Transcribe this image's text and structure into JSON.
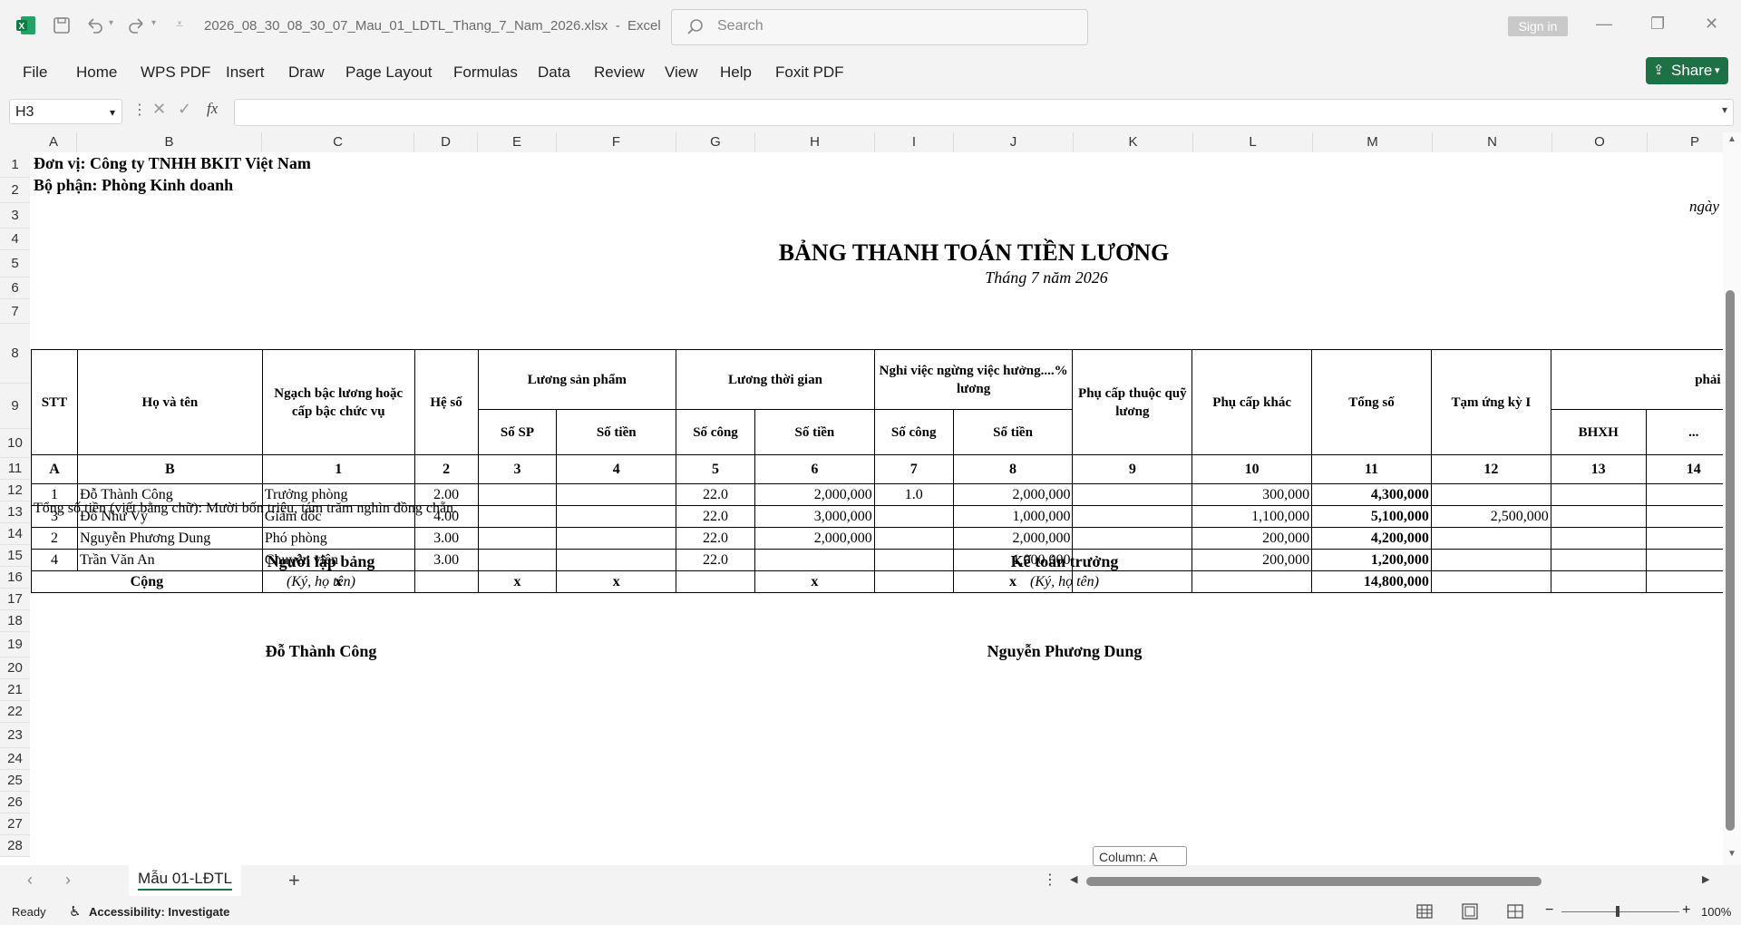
{
  "app": {
    "file_name": "2026_08_30_08_30_07_Mau_01_LDTL_Thang_7_Nam_2026.xlsx",
    "separator": "-",
    "app_name": "Excel",
    "search_placeholder": "Search",
    "sign_in": "Sign in",
    "share_label": "Share"
  },
  "ribbon_tabs": [
    "File",
    "Home",
    "WPS PDF",
    "Insert",
    "Draw",
    "Page Layout",
    "Formulas",
    "Data",
    "Review",
    "View",
    "Help",
    "Foxit PDF"
  ],
  "formula_bar": {
    "cell_ref": "H3",
    "fx": "fx",
    "formula": ""
  },
  "columns": [
    "A",
    "B",
    "C",
    "D",
    "E",
    "F",
    "G",
    "H",
    "I",
    "J",
    "K",
    "L",
    "M",
    "N",
    "O",
    "P"
  ],
  "rows": [
    "1",
    "2",
    "3",
    "4",
    "5",
    "6",
    "7",
    "8",
    "9",
    "10",
    "11",
    "12",
    "13",
    "14",
    "15",
    "16",
    "17",
    "18",
    "19",
    "20",
    "21",
    "22",
    "23",
    "24",
    "25",
    "26",
    "27",
    "28"
  ],
  "sheet": {
    "unit": "Đơn vị: Công ty TNHH BKIT Việt Nam",
    "department": "Bộ phận: Phòng Kinh doanh",
    "date_fragment": "ngày",
    "title": "BẢNG THANH TOÁN TIỀN LƯƠNG",
    "subtitle": "Tháng 7 năm 2026",
    "headers": {
      "stt": "STT",
      "name": "Họ và tên",
      "grade": "Ngạch bậc lương hoặc cấp bậc chức vụ",
      "coef": "Hệ số",
      "product_salary": "Lương sản phẩm",
      "time_salary": "Lương thời gian",
      "leave": "Nghỉ việc ngừng việc hưởng....% lương",
      "allowance_fund": "Phụ cấp thuộc quỹ lương",
      "allowance_other": "Phụ cấp khác",
      "total": "Tổng số",
      "advance": "Tạm ứng kỳ I",
      "deduct": "phải kh",
      "sp_count": "Số SP",
      "amount": "Số tiền",
      "work_days": "Số công",
      "bhxh": "BHXH",
      "ellipsis": "..."
    },
    "index_row": [
      "A",
      "B",
      "1",
      "2",
      "3",
      "4",
      "5",
      "6",
      "7",
      "8",
      "9",
      "10",
      "11",
      "12",
      "13",
      "14"
    ],
    "data_rows": [
      [
        "1",
        "Đỗ Thành Công",
        "Trưởng phòng",
        "2.00",
        "",
        "",
        "22.0",
        "2,000,000",
        "1.0",
        "2,000,000",
        "",
        "300,000",
        "4,300,000",
        "",
        "",
        ""
      ],
      [
        "3",
        "Đỗ Như Vý",
        "Giám đốc",
        "4.00",
        "",
        "",
        "22.0",
        "3,000,000",
        "",
        "1,000,000",
        "",
        "1,100,000",
        "5,100,000",
        "2,500,000",
        "",
        ""
      ],
      [
        "2",
        "Nguyễn Phương Dung",
        "Phó phòng",
        "3.00",
        "",
        "",
        "22.0",
        "2,000,000",
        "",
        "2,000,000",
        "",
        "200,000",
        "4,200,000",
        "",
        "",
        ""
      ],
      [
        "4",
        "Trần Văn An",
        "Chuyên viên",
        "3.00",
        "",
        "",
        "22.0",
        "",
        "",
        "1,000,000",
        "",
        "200,000",
        "1,200,000",
        "",
        "",
        ""
      ]
    ],
    "total_row": [
      "Cộng",
      "",
      "x",
      "",
      "x",
      "x",
      "",
      "x",
      "",
      "x",
      "",
      "",
      "14,800,000",
      "",
      "",
      ""
    ],
    "total_in_words": "Tổng số tiền (viết bằng chữ): Mười bốn triệu, tám trăm nghìn đồng chẵn.",
    "preparer_title": "Người lập bảng",
    "preparer_sign": "(Ký, họ tên)",
    "preparer_name": "Đỗ Thành Công",
    "accountant_title": "Kế toán trưởng",
    "accountant_sign": "(Ký, họ tên)",
    "accountant_name": "Nguyễn Phương Dung"
  },
  "sheet_tab": "Mẫu 01-LĐTL",
  "tooltip": "Column: A",
  "status": {
    "ready": "Ready",
    "accessibility": "Accessibility: Investigate",
    "zoom": "100%"
  }
}
